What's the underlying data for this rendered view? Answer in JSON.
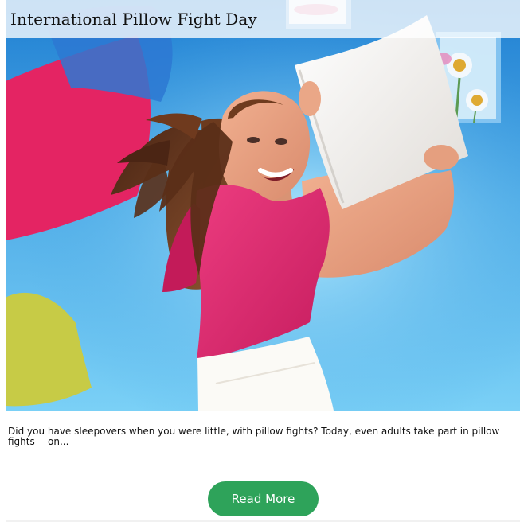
{
  "card": {
    "title": "International Pillow Fight Day",
    "excerpt": "Did you have sleepovers when you were little, with pillow fights? Today, even adults take part in pillow fights -- on...",
    "button_label": "Read More"
  },
  "colors": {
    "button": "#2ea35a",
    "title_bar": "#ffffff",
    "hero_sky": "#6fb6e6",
    "pillow_pink": "#df2f63",
    "pillow_yellow": "#c8d04f",
    "shirt_pink": "#db2f72"
  },
  "icons": {
    "hero_image": "pillow-fight-photo"
  }
}
